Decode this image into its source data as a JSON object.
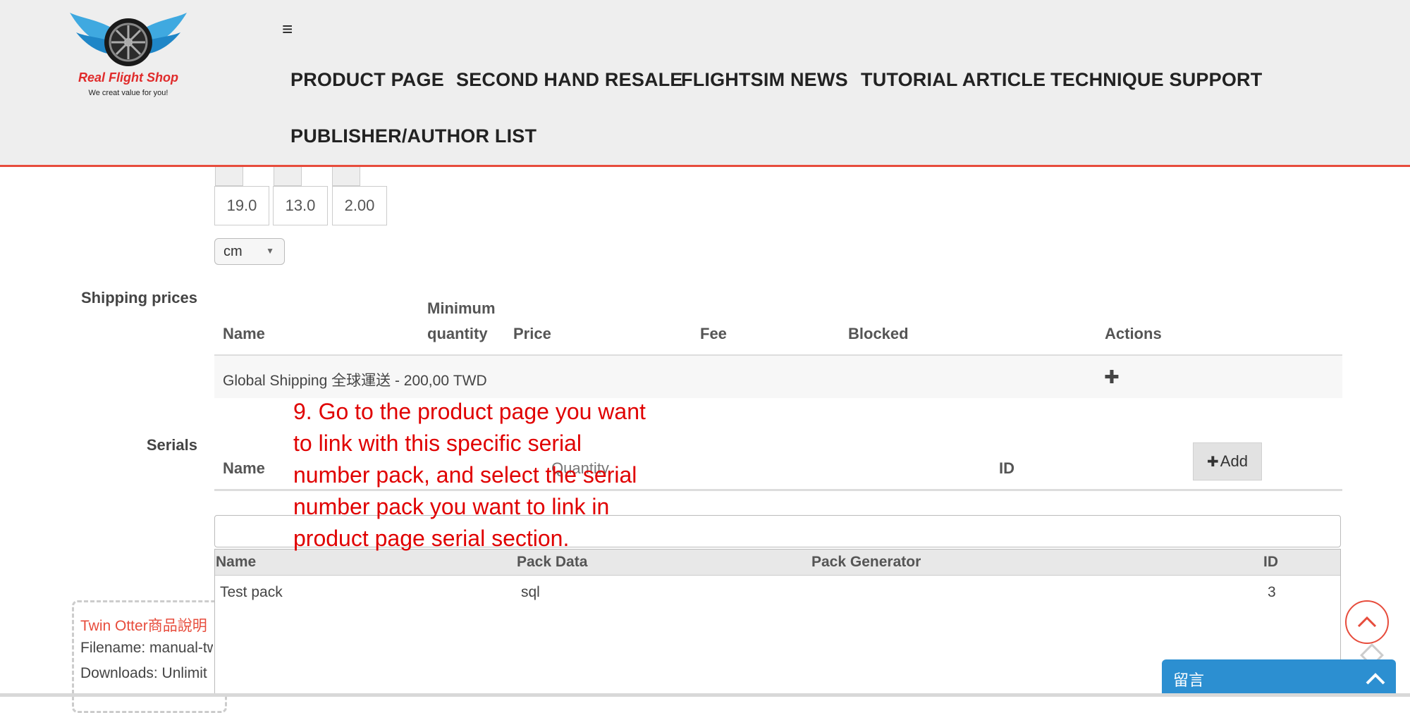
{
  "header": {
    "logo_name": "Real Flight Shop",
    "logo_tagline": "We creat value for you!",
    "menu_icon": "hamburger-menu-icon",
    "nav": [
      "PRODUCT PAGE",
      "SECOND HAND RESALE",
      "FLIGHTSIM NEWS",
      "TUTORIAL ARTICLE",
      "TECHNIQUE SUPPORT",
      "PUBLISHER/AUTHOR LIST"
    ],
    "accent_color": "#e74c3c"
  },
  "dimensions": {
    "values": [
      "19.0",
      "13.0",
      "2.00"
    ],
    "unit": "cm"
  },
  "shipping": {
    "label": "Shipping prices",
    "headers": {
      "name": "Name",
      "min_qty_1": "Minimum",
      "min_qty_2": "quantity",
      "price": "Price",
      "fee": "Fee",
      "blocked": "Blocked",
      "actions": "Actions"
    },
    "rows": [
      {
        "name": "Global Shipping 全球運送 - 200,00 TWD",
        "action_icon": "plus-icon"
      }
    ]
  },
  "serials": {
    "label": "Serials",
    "headers": {
      "name": "Name",
      "quantity": "Quantity",
      "id": "ID"
    },
    "add_button": "Add",
    "search_value": "",
    "dropdown": {
      "headers": {
        "name": "Name",
        "pack_data": "Pack Data",
        "pack_generator": "Pack Generator",
        "id": "ID"
      },
      "rows": [
        {
          "name": "Test pack",
          "pack_data": "sql",
          "pack_generator": "",
          "id": "3"
        }
      ]
    }
  },
  "download_box": {
    "title": "Twin Otter商品說明",
    "filename": "Filename: manual-tw",
    "downloads": "Downloads: Unlimit"
  },
  "overlay_text": "9. Go to the product page you want to link with this specific serial number pack, and select the serial number pack you want to link in product page serial section.",
  "widgets": {
    "scroll_top_icon": "chevron-up-icon",
    "chat_label": "留言",
    "chat_icon": "chevron-up-icon",
    "chat_color": "#2c8fd1"
  }
}
